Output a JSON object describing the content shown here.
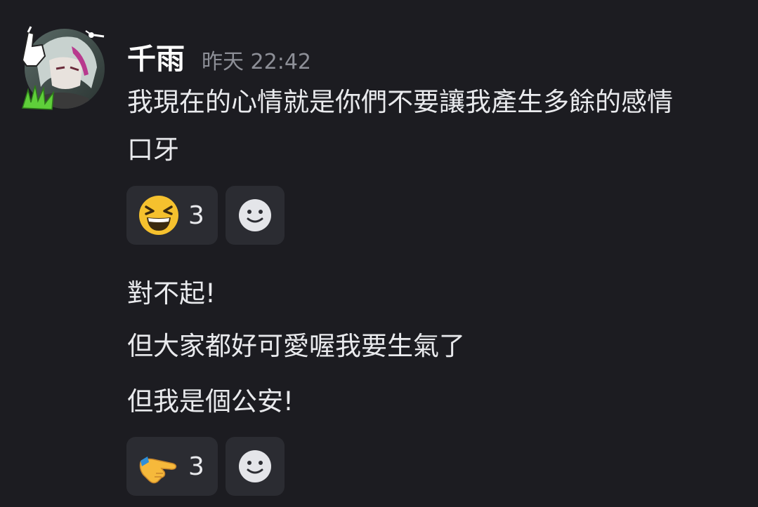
{
  "message": {
    "username": "千雨",
    "timestamp": "昨天 22:42",
    "lines": [
      "我現在的心情就是你們不要讓我產生多餘的感情",
      "口牙"
    ],
    "reaction": {
      "icon": "laughing-squinting-face-icon",
      "count": "3"
    }
  },
  "message2": {
    "lines": [
      "對不起!",
      "但大家都好可愛喔我要生氣了",
      "但我是個公安!"
    ],
    "reaction": {
      "icon": "pointing-hand-icon",
      "count": "3"
    }
  },
  "colors": {
    "background": "#1c1c21",
    "reaction_bg": "#2b2c32",
    "text": "#e9eaed",
    "muted": "#8d8f97"
  },
  "add_reaction_icon": "smiley-add-reaction-icon"
}
